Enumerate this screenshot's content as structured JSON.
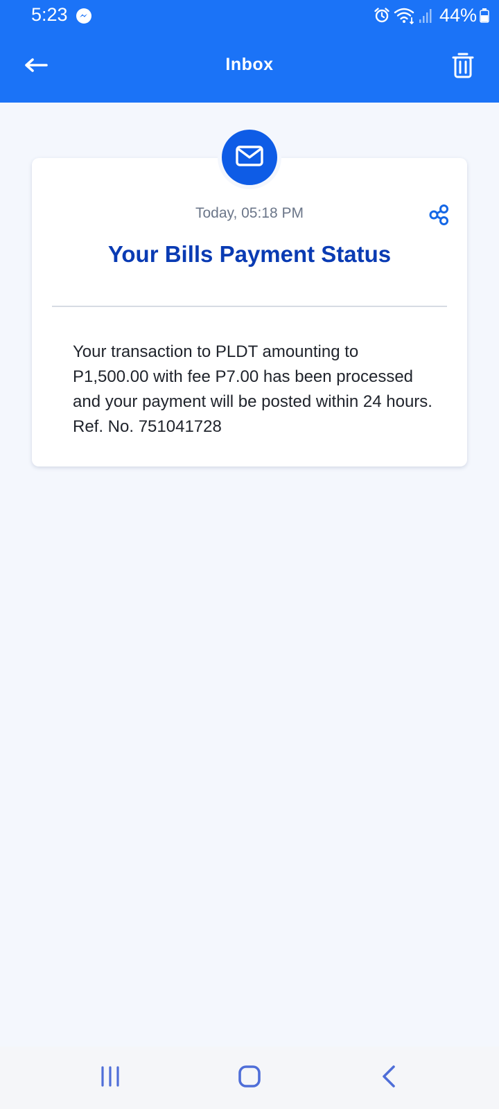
{
  "status_bar": {
    "time": "5:23",
    "battery": "44%"
  },
  "header": {
    "title": "Inbox"
  },
  "message": {
    "timestamp": "Today, 05:18 PM",
    "title": "Your Bills Payment Status",
    "body": "Your transaction to PLDT amounting to P1,500.00 with fee P7.00 has been processed and your payment will be posted within 24 hours. Ref. No. 751041728"
  },
  "icons": {
    "back": "arrow-left-icon",
    "delete": "trash-icon",
    "badge": "envelope-icon",
    "share": "share-icon",
    "nav_recents": "recents-icon",
    "nav_home": "home-icon",
    "nav_back": "chevron-left-icon"
  },
  "colors": {
    "header": "#1b73f7",
    "accent": "#0e5ce6",
    "title": "#0a3bb3",
    "background": "#f4f7fd"
  }
}
